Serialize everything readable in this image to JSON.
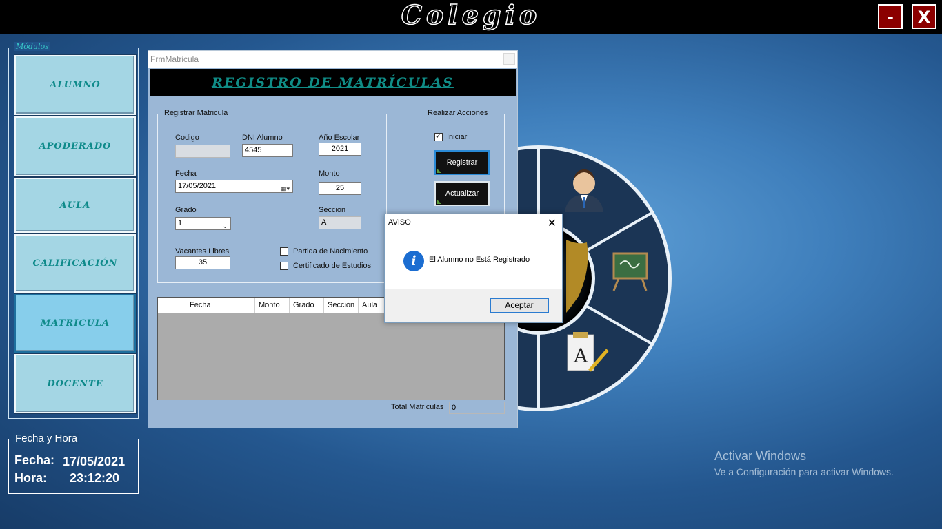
{
  "app": {
    "title": "Colegio",
    "minimize_label": "-",
    "close_label": "X"
  },
  "sidebar": {
    "legend": "Módulos",
    "items": [
      {
        "label": "ALUMNO"
      },
      {
        "label": "APODERADO"
      },
      {
        "label": "AULA"
      },
      {
        "label": "CALIFICACIÓN"
      },
      {
        "label": "MATRICULA"
      },
      {
        "label": "DOCENTE"
      }
    ]
  },
  "datetime": {
    "legend": "Fecha y Hora",
    "fecha_label": "Fecha:",
    "fecha_value": "17/05/2021",
    "hora_label": "Hora:",
    "hora_value": "23:12:20"
  },
  "form": {
    "window_title": "FrmMatricula",
    "header": "REGISTRO DE MATRÍCULAS",
    "registrar_group": {
      "legend": "Registrar Matricula",
      "codigo_label": "Codigo",
      "codigo_value": "",
      "dni_label": "DNI Alumno",
      "dni_value": "4545",
      "anio_label": "Año Escolar",
      "anio_value": "2021",
      "fecha_label": "Fecha",
      "fecha_value": "17/05/2021",
      "monto_label": "Monto",
      "monto_value": "25",
      "grado_label": "Grado",
      "grado_value": "1",
      "seccion_label": "Seccion",
      "seccion_value": "A",
      "vacantes_label": "Vacantes Libres",
      "vacantes_value": "35",
      "partida_label": "Partida de Nacimiento",
      "certificado_label": "Certificado de Estudios"
    },
    "acciones_group": {
      "legend": "Realizar Acciones",
      "iniciar_label": "Iniciar",
      "iniciar_checked": true,
      "registrar_label": "Registrar",
      "actualizar_label": "Actualizar"
    },
    "grid": {
      "columns": [
        "",
        "Fecha",
        "Monto",
        "Grado",
        "Sección",
        "Aula"
      ]
    },
    "total_label": "Total Matriculas",
    "total_value": "0"
  },
  "dialog": {
    "title": "AVISO",
    "message": "El Alumno no Está Registrado",
    "ok_label": "Aceptar"
  },
  "watermark": {
    "line1": "Activar Windows",
    "line2": "Ve a Configuración para activar Windows."
  },
  "colors": {
    "module_button": "#a4d6e4",
    "module_active": "#87ceeb",
    "module_text": "#0e8a8a",
    "header_text": "#108d87",
    "close_button": "#8b0000",
    "form_background": "#9bb7d6"
  }
}
